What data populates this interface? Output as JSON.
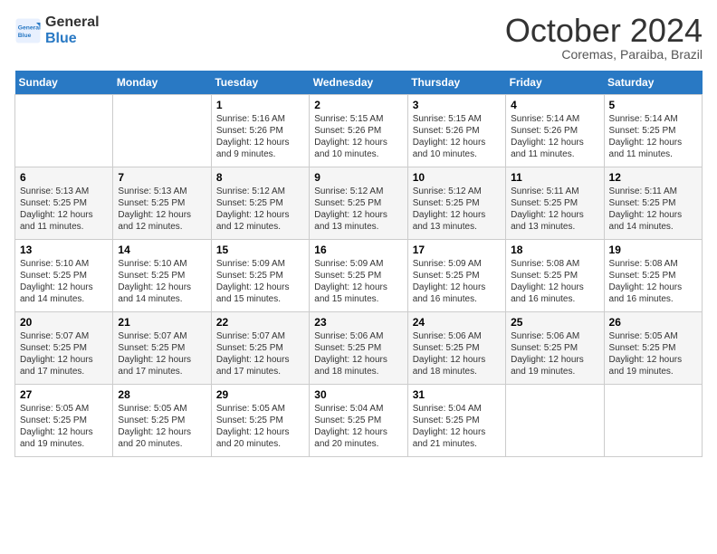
{
  "logo": {
    "line1": "General",
    "line2": "Blue"
  },
  "header": {
    "month": "October 2024",
    "location": "Coremas, Paraiba, Brazil"
  },
  "weekdays": [
    "Sunday",
    "Monday",
    "Tuesday",
    "Wednesday",
    "Thursday",
    "Friday",
    "Saturday"
  ],
  "weeks": [
    [
      {
        "day": "",
        "info": ""
      },
      {
        "day": "",
        "info": ""
      },
      {
        "day": "1",
        "info": "Sunrise: 5:16 AM\nSunset: 5:26 PM\nDaylight: 12 hours and 9 minutes."
      },
      {
        "day": "2",
        "info": "Sunrise: 5:15 AM\nSunset: 5:26 PM\nDaylight: 12 hours and 10 minutes."
      },
      {
        "day": "3",
        "info": "Sunrise: 5:15 AM\nSunset: 5:26 PM\nDaylight: 12 hours and 10 minutes."
      },
      {
        "day": "4",
        "info": "Sunrise: 5:14 AM\nSunset: 5:26 PM\nDaylight: 12 hours and 11 minutes."
      },
      {
        "day": "5",
        "info": "Sunrise: 5:14 AM\nSunset: 5:25 PM\nDaylight: 12 hours and 11 minutes."
      }
    ],
    [
      {
        "day": "6",
        "info": "Sunrise: 5:13 AM\nSunset: 5:25 PM\nDaylight: 12 hours and 11 minutes."
      },
      {
        "day": "7",
        "info": "Sunrise: 5:13 AM\nSunset: 5:25 PM\nDaylight: 12 hours and 12 minutes."
      },
      {
        "day": "8",
        "info": "Sunrise: 5:12 AM\nSunset: 5:25 PM\nDaylight: 12 hours and 12 minutes."
      },
      {
        "day": "9",
        "info": "Sunrise: 5:12 AM\nSunset: 5:25 PM\nDaylight: 12 hours and 13 minutes."
      },
      {
        "day": "10",
        "info": "Sunrise: 5:12 AM\nSunset: 5:25 PM\nDaylight: 12 hours and 13 minutes."
      },
      {
        "day": "11",
        "info": "Sunrise: 5:11 AM\nSunset: 5:25 PM\nDaylight: 12 hours and 13 minutes."
      },
      {
        "day": "12",
        "info": "Sunrise: 5:11 AM\nSunset: 5:25 PM\nDaylight: 12 hours and 14 minutes."
      }
    ],
    [
      {
        "day": "13",
        "info": "Sunrise: 5:10 AM\nSunset: 5:25 PM\nDaylight: 12 hours and 14 minutes."
      },
      {
        "day": "14",
        "info": "Sunrise: 5:10 AM\nSunset: 5:25 PM\nDaylight: 12 hours and 14 minutes."
      },
      {
        "day": "15",
        "info": "Sunrise: 5:09 AM\nSunset: 5:25 PM\nDaylight: 12 hours and 15 minutes."
      },
      {
        "day": "16",
        "info": "Sunrise: 5:09 AM\nSunset: 5:25 PM\nDaylight: 12 hours and 15 minutes."
      },
      {
        "day": "17",
        "info": "Sunrise: 5:09 AM\nSunset: 5:25 PM\nDaylight: 12 hours and 16 minutes."
      },
      {
        "day": "18",
        "info": "Sunrise: 5:08 AM\nSunset: 5:25 PM\nDaylight: 12 hours and 16 minutes."
      },
      {
        "day": "19",
        "info": "Sunrise: 5:08 AM\nSunset: 5:25 PM\nDaylight: 12 hours and 16 minutes."
      }
    ],
    [
      {
        "day": "20",
        "info": "Sunrise: 5:07 AM\nSunset: 5:25 PM\nDaylight: 12 hours and 17 minutes."
      },
      {
        "day": "21",
        "info": "Sunrise: 5:07 AM\nSunset: 5:25 PM\nDaylight: 12 hours and 17 minutes."
      },
      {
        "day": "22",
        "info": "Sunrise: 5:07 AM\nSunset: 5:25 PM\nDaylight: 12 hours and 17 minutes."
      },
      {
        "day": "23",
        "info": "Sunrise: 5:06 AM\nSunset: 5:25 PM\nDaylight: 12 hours and 18 minutes."
      },
      {
        "day": "24",
        "info": "Sunrise: 5:06 AM\nSunset: 5:25 PM\nDaylight: 12 hours and 18 minutes."
      },
      {
        "day": "25",
        "info": "Sunrise: 5:06 AM\nSunset: 5:25 PM\nDaylight: 12 hours and 19 minutes."
      },
      {
        "day": "26",
        "info": "Sunrise: 5:05 AM\nSunset: 5:25 PM\nDaylight: 12 hours and 19 minutes."
      }
    ],
    [
      {
        "day": "27",
        "info": "Sunrise: 5:05 AM\nSunset: 5:25 PM\nDaylight: 12 hours and 19 minutes."
      },
      {
        "day": "28",
        "info": "Sunrise: 5:05 AM\nSunset: 5:25 PM\nDaylight: 12 hours and 20 minutes."
      },
      {
        "day": "29",
        "info": "Sunrise: 5:05 AM\nSunset: 5:25 PM\nDaylight: 12 hours and 20 minutes."
      },
      {
        "day": "30",
        "info": "Sunrise: 5:04 AM\nSunset: 5:25 PM\nDaylight: 12 hours and 20 minutes."
      },
      {
        "day": "31",
        "info": "Sunrise: 5:04 AM\nSunset: 5:25 PM\nDaylight: 12 hours and 21 minutes."
      },
      {
        "day": "",
        "info": ""
      },
      {
        "day": "",
        "info": ""
      }
    ]
  ]
}
